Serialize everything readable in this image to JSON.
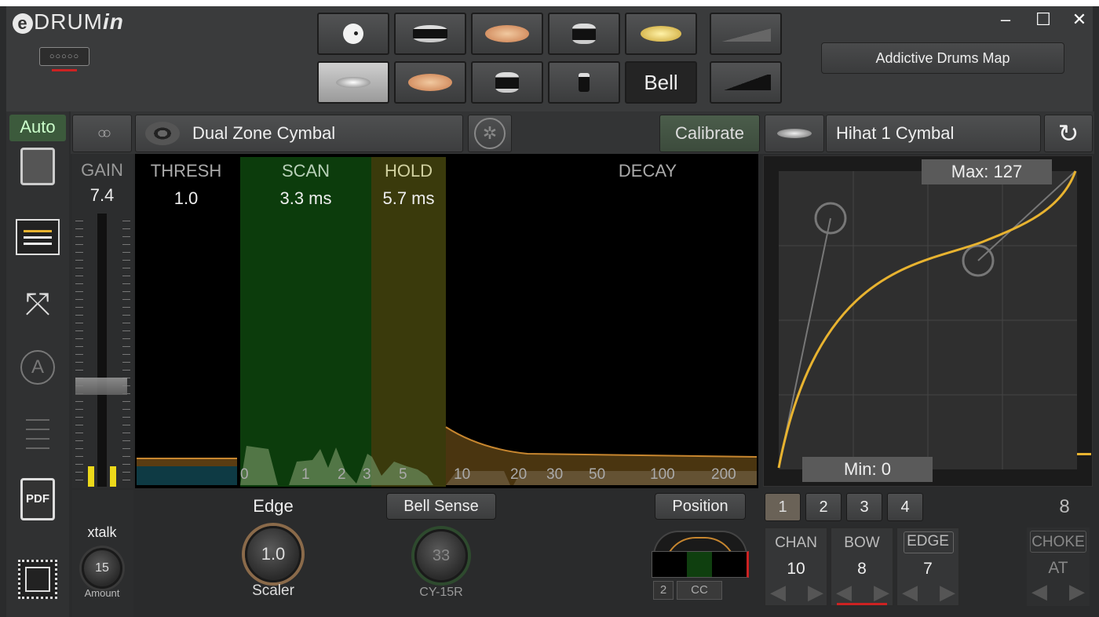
{
  "header": {
    "logo_prefix": "e",
    "logo_main": "DRUM",
    "logo_suffix": "in",
    "usb_port": "○○○○○",
    "pad_tiles_row1": [
      "kick-icon",
      "snare-icon",
      "crash-icon",
      "tom-icon",
      "ride-icon",
      "pedal-dim-icon"
    ],
    "pad_tiles_row2": [
      "hihat-icon",
      "crash2-icon",
      "floor-tom-icon",
      "small-tom-icon",
      "bell",
      "pedal-icon"
    ],
    "bell_label": "Bell",
    "minimize": "–",
    "maximize": "☐",
    "close": "✕",
    "map_button": "Addictive Drums Map"
  },
  "sidebar": {
    "auto_label": "Auto",
    "pdf_label": "PDF",
    "a_label": "A",
    "route_glyph": "⤧"
  },
  "toolbar": {
    "pad_type": "Dual Zone Cymbal",
    "calibrate": "Calibrate",
    "target_instrument": "Hihat 1 Cymbal",
    "refresh_glyph": "↻",
    "rings_glyph": "○○",
    "yamaha_glyph": "✲"
  },
  "params": {
    "gain_label": "GAIN",
    "gain_value": "7.4",
    "gain_level": 0.36,
    "thresh_label": "THRESH",
    "thresh_value": "1.0",
    "scan_label": "SCAN",
    "scan_value": "3.3 ms",
    "hold_label": "HOLD",
    "hold_value": "5.7 ms",
    "decay_label": "DECAY",
    "axis_ticks": [
      "0",
      "1",
      "2",
      "3",
      "5",
      "10",
      "20",
      "30",
      "50",
      "100",
      "200"
    ]
  },
  "curve": {
    "max_label": "Max: 127",
    "min_label": "Min: 0"
  },
  "bottom": {
    "xtalk_label": "xtalk",
    "xtalk_value": "15",
    "amount_label": "Amount",
    "edge_label": "Edge",
    "edge_value": "1.0",
    "scaler_label": "Scaler",
    "bell_sense_label": "Bell Sense",
    "bell_sense_value": "33",
    "module_label": "CY-15R",
    "position_label": "Position",
    "pos_num": "2",
    "pos_cc": "CC",
    "tabs": [
      "1",
      "2",
      "3",
      "4"
    ],
    "right_number": "8",
    "chan_label": "CHAN",
    "chan_value": "10",
    "bow_label": "BOW",
    "bow_value": "8",
    "edge_note_label": "EDGE",
    "edge_note_value": "7",
    "choke_label": "CHOKE",
    "choke_value": "AT",
    "arrow_left": "◀",
    "arrow_right": "▶"
  },
  "colors": {
    "accent": "#e8b330",
    "scan_zone": "#0c3c0c",
    "hold_zone": "#3a3a0c",
    "meter": "#ecd81a",
    "alert": "#cc2222"
  }
}
